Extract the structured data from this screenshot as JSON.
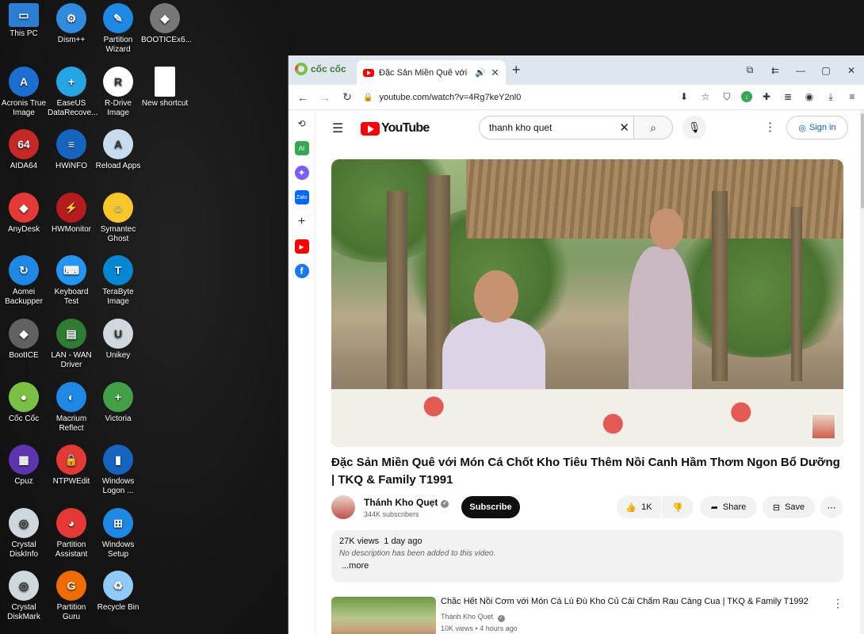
{
  "desktop": {
    "icons": [
      {
        "label": "This PC",
        "icon": "monitor-icon",
        "color": "#2a7fd4",
        "glyph": "▭"
      },
      {
        "label": "Dism++",
        "icon": "gears-icon",
        "color": "#2f8be0",
        "glyph": "⚙"
      },
      {
        "label": "Partition\nWizard",
        "icon": "partition-wizard-icon",
        "color": "#1e88e5",
        "glyph": "✎"
      },
      {
        "label": "BOOTICEx6...",
        "icon": "booticex64-icon",
        "color": "#777777",
        "glyph": "◆"
      },
      {
        "label": "Acronis True\nImage",
        "icon": "acronis-icon",
        "color": "#1a6fd0",
        "glyph": "A"
      },
      {
        "label": "EaseUS\nDataRecove...",
        "icon": "easeus-icon",
        "color": "#26a5e4",
        "glyph": "+"
      },
      {
        "label": "R-Drive\nImage",
        "icon": "rdrive-icon",
        "color": "#ffffff",
        "glyph": "R"
      },
      {
        "label": "New shortcut",
        "icon": "blank-file-icon",
        "color": "#ffffff",
        "glyph": ""
      },
      {
        "label": "AIDA64",
        "icon": "aida64-icon",
        "color": "#c62828",
        "glyph": "64"
      },
      {
        "label": "HWiNFO",
        "icon": "hwinfo-icon",
        "color": "#1565c0",
        "glyph": "≡"
      },
      {
        "label": "Reload Apps",
        "icon": "reload-apps-icon",
        "color": "#c8dcef",
        "glyph": "A"
      },
      {
        "label": "AnyDesk",
        "icon": "anydesk-icon",
        "color": "#e53935",
        "glyph": "◆"
      },
      {
        "label": "HWMonitor",
        "icon": "hwmonitor-icon",
        "color": "#b71c1c",
        "glyph": "⚡"
      },
      {
        "label": "Symantec\nGhost",
        "icon": "ghost-icon",
        "color": "#f9c72a",
        "glyph": "☺"
      },
      {
        "label": "Aomei\nBackupper",
        "icon": "aomei-icon",
        "color": "#1e88e5",
        "glyph": "↻"
      },
      {
        "label": "Keyboard\nTest",
        "icon": "keyboard-icon",
        "color": "#2196f3",
        "glyph": "⌨"
      },
      {
        "label": "TeraByte\nImage",
        "icon": "terabyte-icon",
        "color": "#0288d1",
        "glyph": "T"
      },
      {
        "label": "BootICE",
        "icon": "bootice-icon",
        "color": "#616161",
        "glyph": "◆"
      },
      {
        "label": "LAN - WAN\nDriver",
        "icon": "network-card-icon",
        "color": "#2e7d32",
        "glyph": "▤"
      },
      {
        "label": "Unikey",
        "icon": "unikey-icon",
        "color": "#cfd8dc",
        "glyph": "U"
      },
      {
        "label": "Cốc Cốc",
        "icon": "coccoc-icon",
        "color": "#7ac143",
        "glyph": "●"
      },
      {
        "label": "Macrium\nReflect",
        "icon": "macrium-icon",
        "color": "#1e88e5",
        "glyph": "◐"
      },
      {
        "label": "Victoria",
        "icon": "victoria-icon",
        "color": "#43a047",
        "glyph": "+"
      },
      {
        "label": "Cpuz",
        "icon": "cpuz-icon",
        "color": "#5e35b1",
        "glyph": "▦"
      },
      {
        "label": "NTPWEdit",
        "icon": "lock-icon",
        "color": "#e53935",
        "glyph": "🔒"
      },
      {
        "label": "Windows\nLogon ...",
        "icon": "windows-logon-icon",
        "color": "#1565c0",
        "glyph": "▮"
      },
      {
        "label": "Crystal\nDiskInfo",
        "icon": "crystaldiskinfo-icon",
        "color": "#cfd8dc",
        "glyph": "◎"
      },
      {
        "label": "Partition\nAssistant",
        "icon": "partition-assistant-icon",
        "color": "#e53935",
        "glyph": "◕"
      },
      {
        "label": "Windows\nSetup",
        "icon": "windows-setup-icon",
        "color": "#1e88e5",
        "glyph": "⊞"
      },
      {
        "label": "Crystal\nDiskMark",
        "icon": "crystaldiskmark-icon",
        "color": "#cfd8dc",
        "glyph": "◎"
      },
      {
        "label": "Partition\nGuru",
        "icon": "partition-guru-icon",
        "color": "#ef6c00",
        "glyph": "G"
      },
      {
        "label": "Recycle Bin",
        "icon": "recycle-bin-icon",
        "color": "#90caf9",
        "glyph": "♻"
      }
    ]
  },
  "browser": {
    "brand": "cốc cốc",
    "tab_title": "Đặc Sản Miền Quê với Mó",
    "url": "youtube.com/watch?v=4Rg7keY2nl0"
  },
  "youtube": {
    "logo_text": "YouTube",
    "search_value": "thanh kho quet",
    "signin_label": "Sign in",
    "video_title": "Đặc Sản Miền Quê với Món Cá Chốt Kho Tiêu Thêm Nồi Canh Hầm Thơm Ngon Bổ Dưỡng | TKQ & Family T1991",
    "channel_name": "Thánh Kho Quẹt",
    "subscribers": "344K subscribers",
    "subscribe_label": "Subscribe",
    "like_count": "1K",
    "share_label": "Share",
    "save_label": "Save",
    "views": "27K views",
    "uploaded": "1 day ago",
    "description": "No description has been added to this video.",
    "more_label": "...more",
    "related": {
      "title": "Chắc Hết Nồi Cơm với Món Cá Lù Đù Kho Củ Cải Chấm Rau Càng Cua | TKQ & Family T1992",
      "channel": "Thánh Kho Quẹt",
      "views": "10K views",
      "age": "4 hours ago"
    }
  }
}
